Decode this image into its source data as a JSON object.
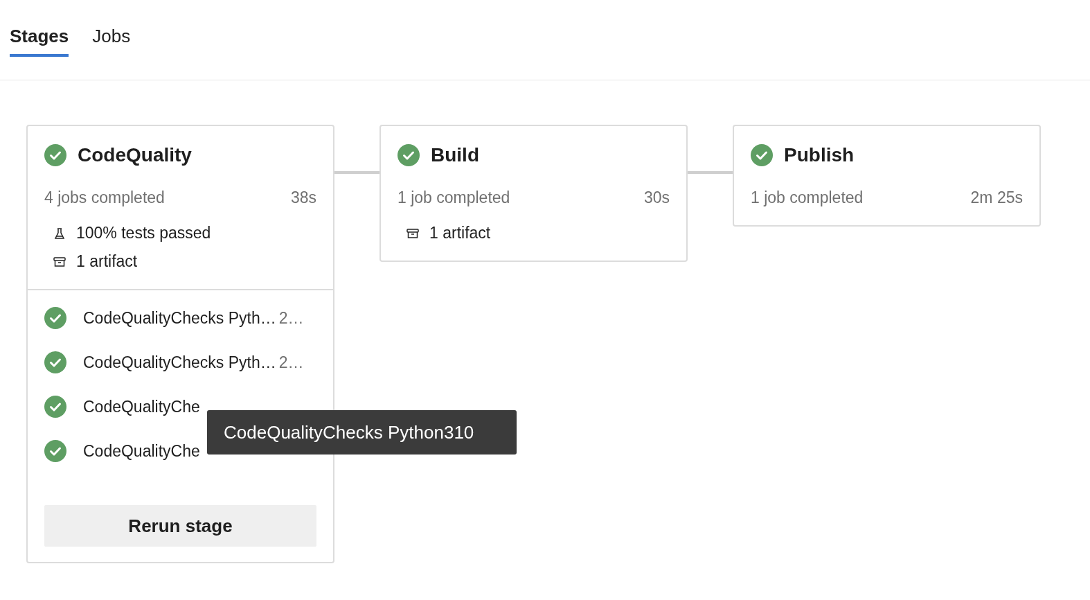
{
  "tabs": [
    {
      "label": "Stages",
      "selected": true
    },
    {
      "label": "Jobs",
      "selected": false
    }
  ],
  "stages": [
    {
      "name": "CodeQuality",
      "passed": true,
      "summary": "4 jobs completed",
      "duration": "38s",
      "details": [
        {
          "kind": "tests",
          "text": "100% tests passed"
        },
        {
          "kind": "artifact",
          "text": "1 artifact"
        }
      ],
      "jobs": [
        {
          "name": "CodeQualityChecks Pyth…",
          "duration": "2…",
          "passed": true
        },
        {
          "name": "CodeQualityChecks Pyth…",
          "duration": "2…",
          "passed": true
        },
        {
          "name": "CodeQualityChe",
          "passed": true
        },
        {
          "name": "CodeQualityChe",
          "passed": true
        }
      ],
      "button": "Rerun stage"
    },
    {
      "name": "Build",
      "passed": true,
      "summary": "1 job completed",
      "duration": "30s",
      "details": [
        {
          "kind": "artifact",
          "text": "1 artifact"
        }
      ]
    },
    {
      "name": "Publish",
      "passed": true,
      "summary": "1 job completed",
      "duration": "2m 25s"
    }
  ],
  "tooltip": "CodeQualityChecks Python310"
}
